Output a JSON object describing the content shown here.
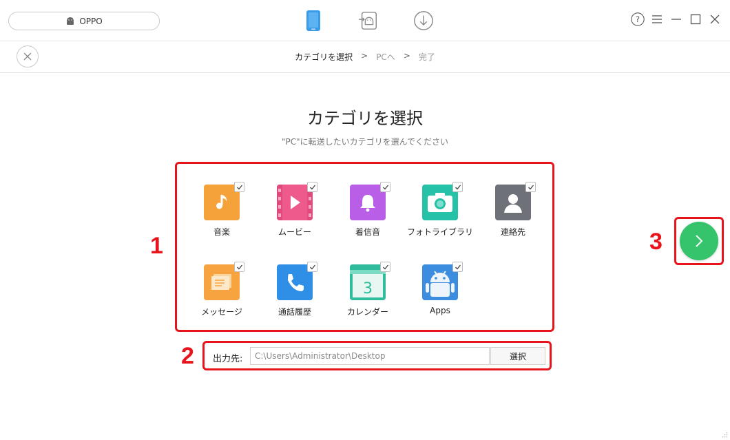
{
  "topbar": {
    "device_name": "OPPO",
    "device_icon": "android-icon",
    "mode_icons": [
      "phone-icon",
      "android-transfer-icon",
      "download-icon"
    ],
    "window_controls": [
      "help-icon",
      "menu-icon",
      "minimize-icon",
      "maximize-icon",
      "close-icon"
    ]
  },
  "breadcrumb": {
    "step1": "カテゴリを選択",
    "sep1": ">",
    "step2": "PCへ",
    "sep2": ">",
    "step3": "完了"
  },
  "main": {
    "title": "カテゴリを選択",
    "subtitle": "\"PC\"に転送したいカテゴリを選んでください"
  },
  "categories": [
    {
      "label": "音楽",
      "icon": "music-icon",
      "color": "#f5a23a",
      "checked": true
    },
    {
      "label": "ムービー",
      "icon": "movie-icon",
      "color": "#ef5a8d",
      "checked": true
    },
    {
      "label": "着信音",
      "icon": "bell-icon",
      "color": "#b95ee6",
      "checked": true
    },
    {
      "label": "フォトライブラリ",
      "icon": "camera-icon",
      "color": "#26c2a8",
      "checked": true
    },
    {
      "label": "連絡先",
      "icon": "contact-icon",
      "color": "#6e7178",
      "checked": true
    },
    {
      "label": "メッセージ",
      "icon": "message-icon",
      "color": "#f7a440",
      "checked": true
    },
    {
      "label": "通話履歴",
      "icon": "phone-call-icon",
      "color": "#2f8ee6",
      "checked": true
    },
    {
      "label": "カレンダー",
      "icon": "calendar-icon",
      "color": "#2fbc9c",
      "calendar_number": "3",
      "checked": true
    },
    {
      "label": "Apps",
      "icon": "android-app-icon",
      "color": "#3c8de0",
      "checked": true
    }
  ],
  "output": {
    "label": "出力先:",
    "path": "C:\\Users\\Administrator\\Desktop",
    "button_label": "選択"
  },
  "annotations": {
    "one": "1",
    "two": "2",
    "three": "3"
  },
  "colors": {
    "annotation_red": "#e8141c",
    "next_green": "#35c46c"
  }
}
